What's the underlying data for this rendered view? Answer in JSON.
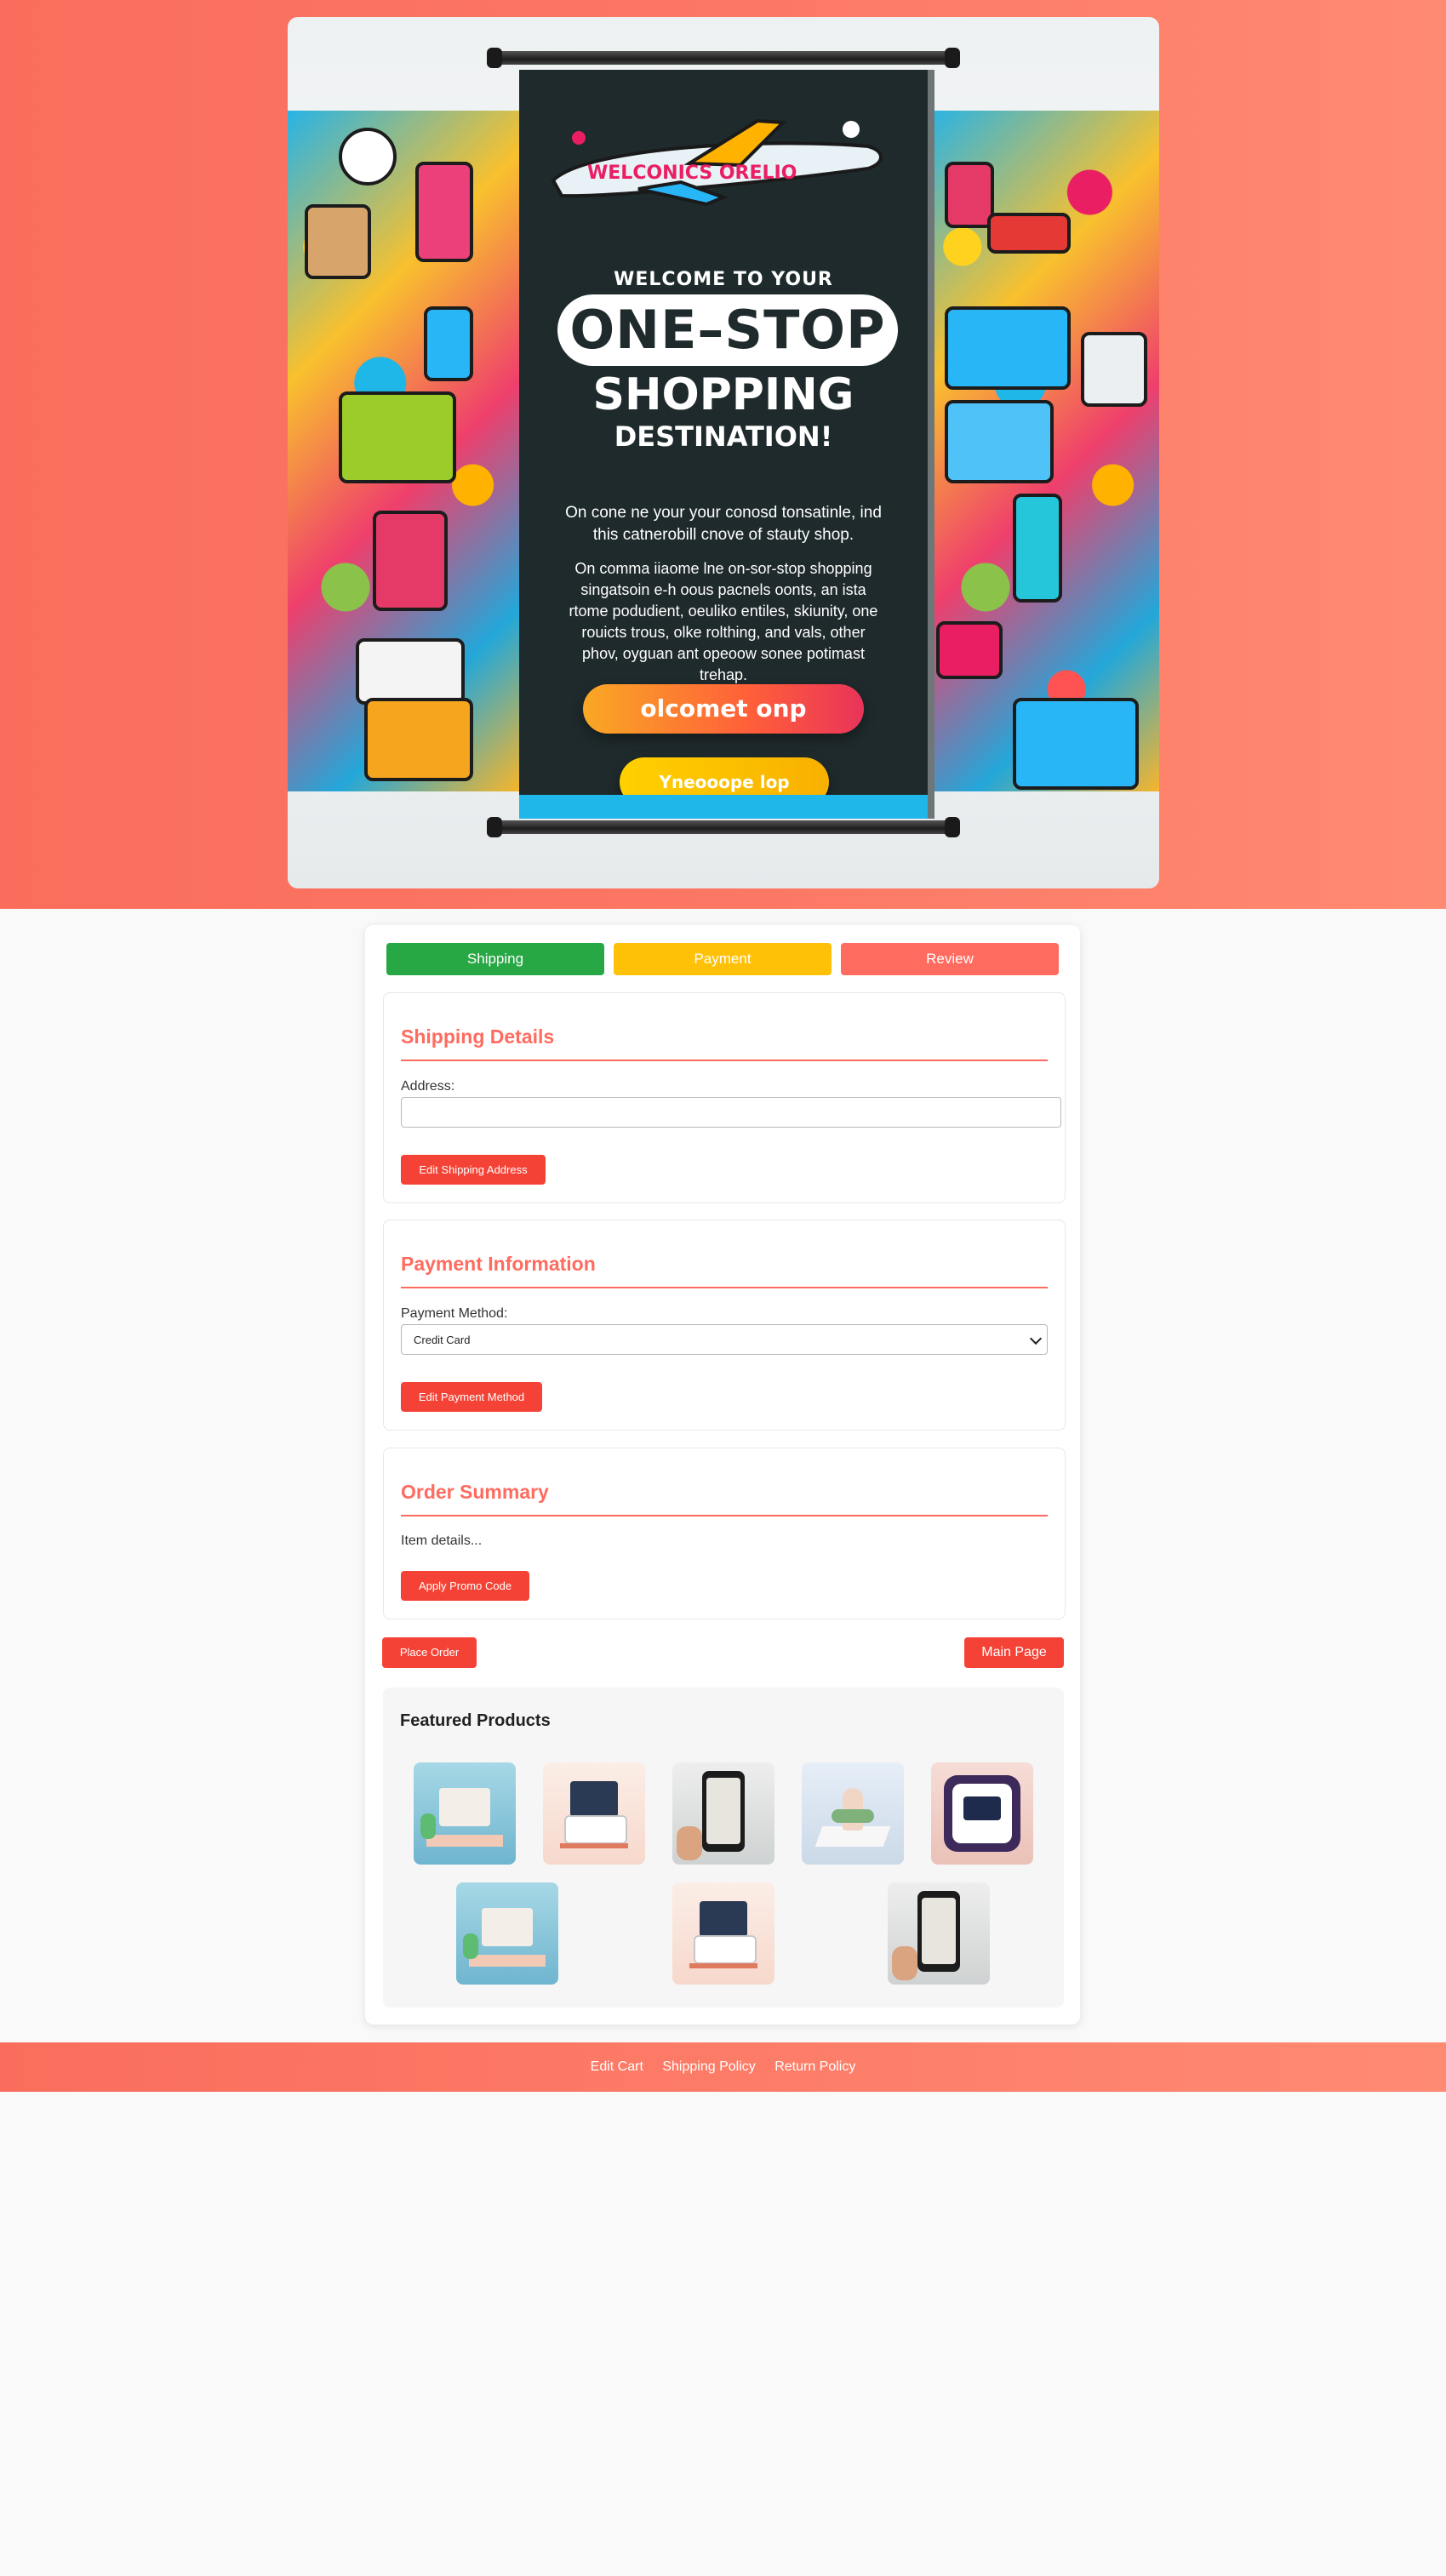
{
  "banner": {
    "welcome": "WELCOME TO YOUR",
    "headline": "ONE–STOP",
    "subheadline": "SHOPPING",
    "destination": "DESTINATION!",
    "plane_text": "WELCONICS ORELIO",
    "paragraph1": "On cone ne your your conosd tonsatinle, ind this catnerobill cnove of stauty shop.",
    "paragraph2": "On comma iiaome lne on-sor-stop shopping singatsoin e-h oous pacnels oonts, an ista rtome podudient, oeuliko entiles, skiunity, one rouicts trous, olke rolthing, and vals, other phov, oyguan ant opeoow sonee potimast trehap.",
    "button_primary": "olcomet onp",
    "button_secondary": "Yneooope lop"
  },
  "steps": [
    {
      "label": "Shipping",
      "color": "#28a745"
    },
    {
      "label": "Payment",
      "color": "#ffc107"
    },
    {
      "label": "Review",
      "color": "#ff6b5e"
    }
  ],
  "shipping": {
    "title": "Shipping Details",
    "address_label": "Address:",
    "address_value": "",
    "edit_button": "Edit Shipping Address"
  },
  "payment": {
    "title": "Payment Information",
    "method_label": "Payment Method:",
    "method_value": "Credit Card",
    "edit_button": "Edit Payment Method"
  },
  "summary": {
    "title": "Order Summary",
    "details": "Item details...",
    "promo_button": "Apply Promo Code"
  },
  "actions": {
    "place_order": "Place Order",
    "main_page": "Main Page"
  },
  "featured": {
    "title": "Featured Products",
    "items": [
      "product-display-icon",
      "product-furniture-icon",
      "product-phone-icon",
      "product-plant-icon",
      "product-payment-icon",
      "product-display-icon",
      "product-furniture-icon",
      "product-phone-icon"
    ]
  },
  "footer": {
    "links": [
      "Edit Cart",
      "Shipping Policy",
      "Return Policy"
    ]
  },
  "colors": {
    "accent": "#ff6b5e",
    "button": "#f44336",
    "success": "#28a745",
    "warning": "#ffc107"
  }
}
